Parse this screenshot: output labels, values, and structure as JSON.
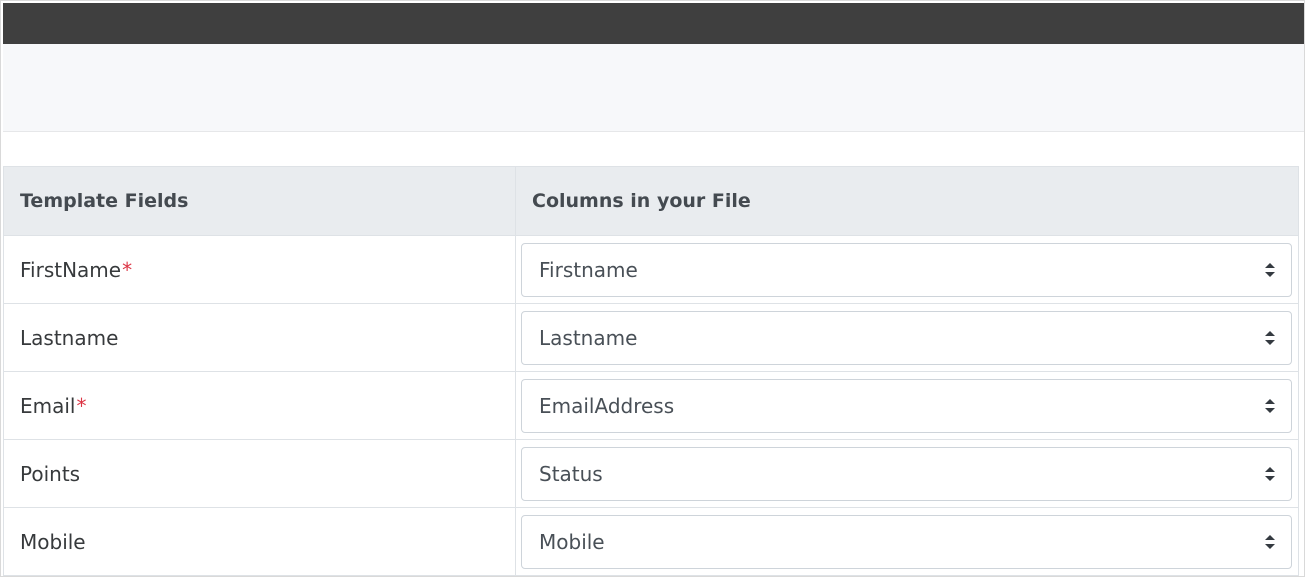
{
  "table": {
    "headers": {
      "template_fields": "Template Fields",
      "columns_in_file": "Columns in your File"
    },
    "rows": [
      {
        "field": "FirstName",
        "required": "*",
        "selected": "Firstname"
      },
      {
        "field": "Lastname",
        "required": "",
        "selected": "Lastname"
      },
      {
        "field": "Email",
        "required": "*",
        "selected": "EmailAddress"
      },
      {
        "field": "Points",
        "required": "",
        "selected": "Status"
      },
      {
        "field": "Mobile",
        "required": "",
        "selected": "Mobile"
      }
    ]
  },
  "icons": {
    "select_arrow": "sort-arrows-icon"
  },
  "colors": {
    "top_bar": "#3f3f3f",
    "required": "#dc3545",
    "header_bg": "#e9ecef"
  }
}
